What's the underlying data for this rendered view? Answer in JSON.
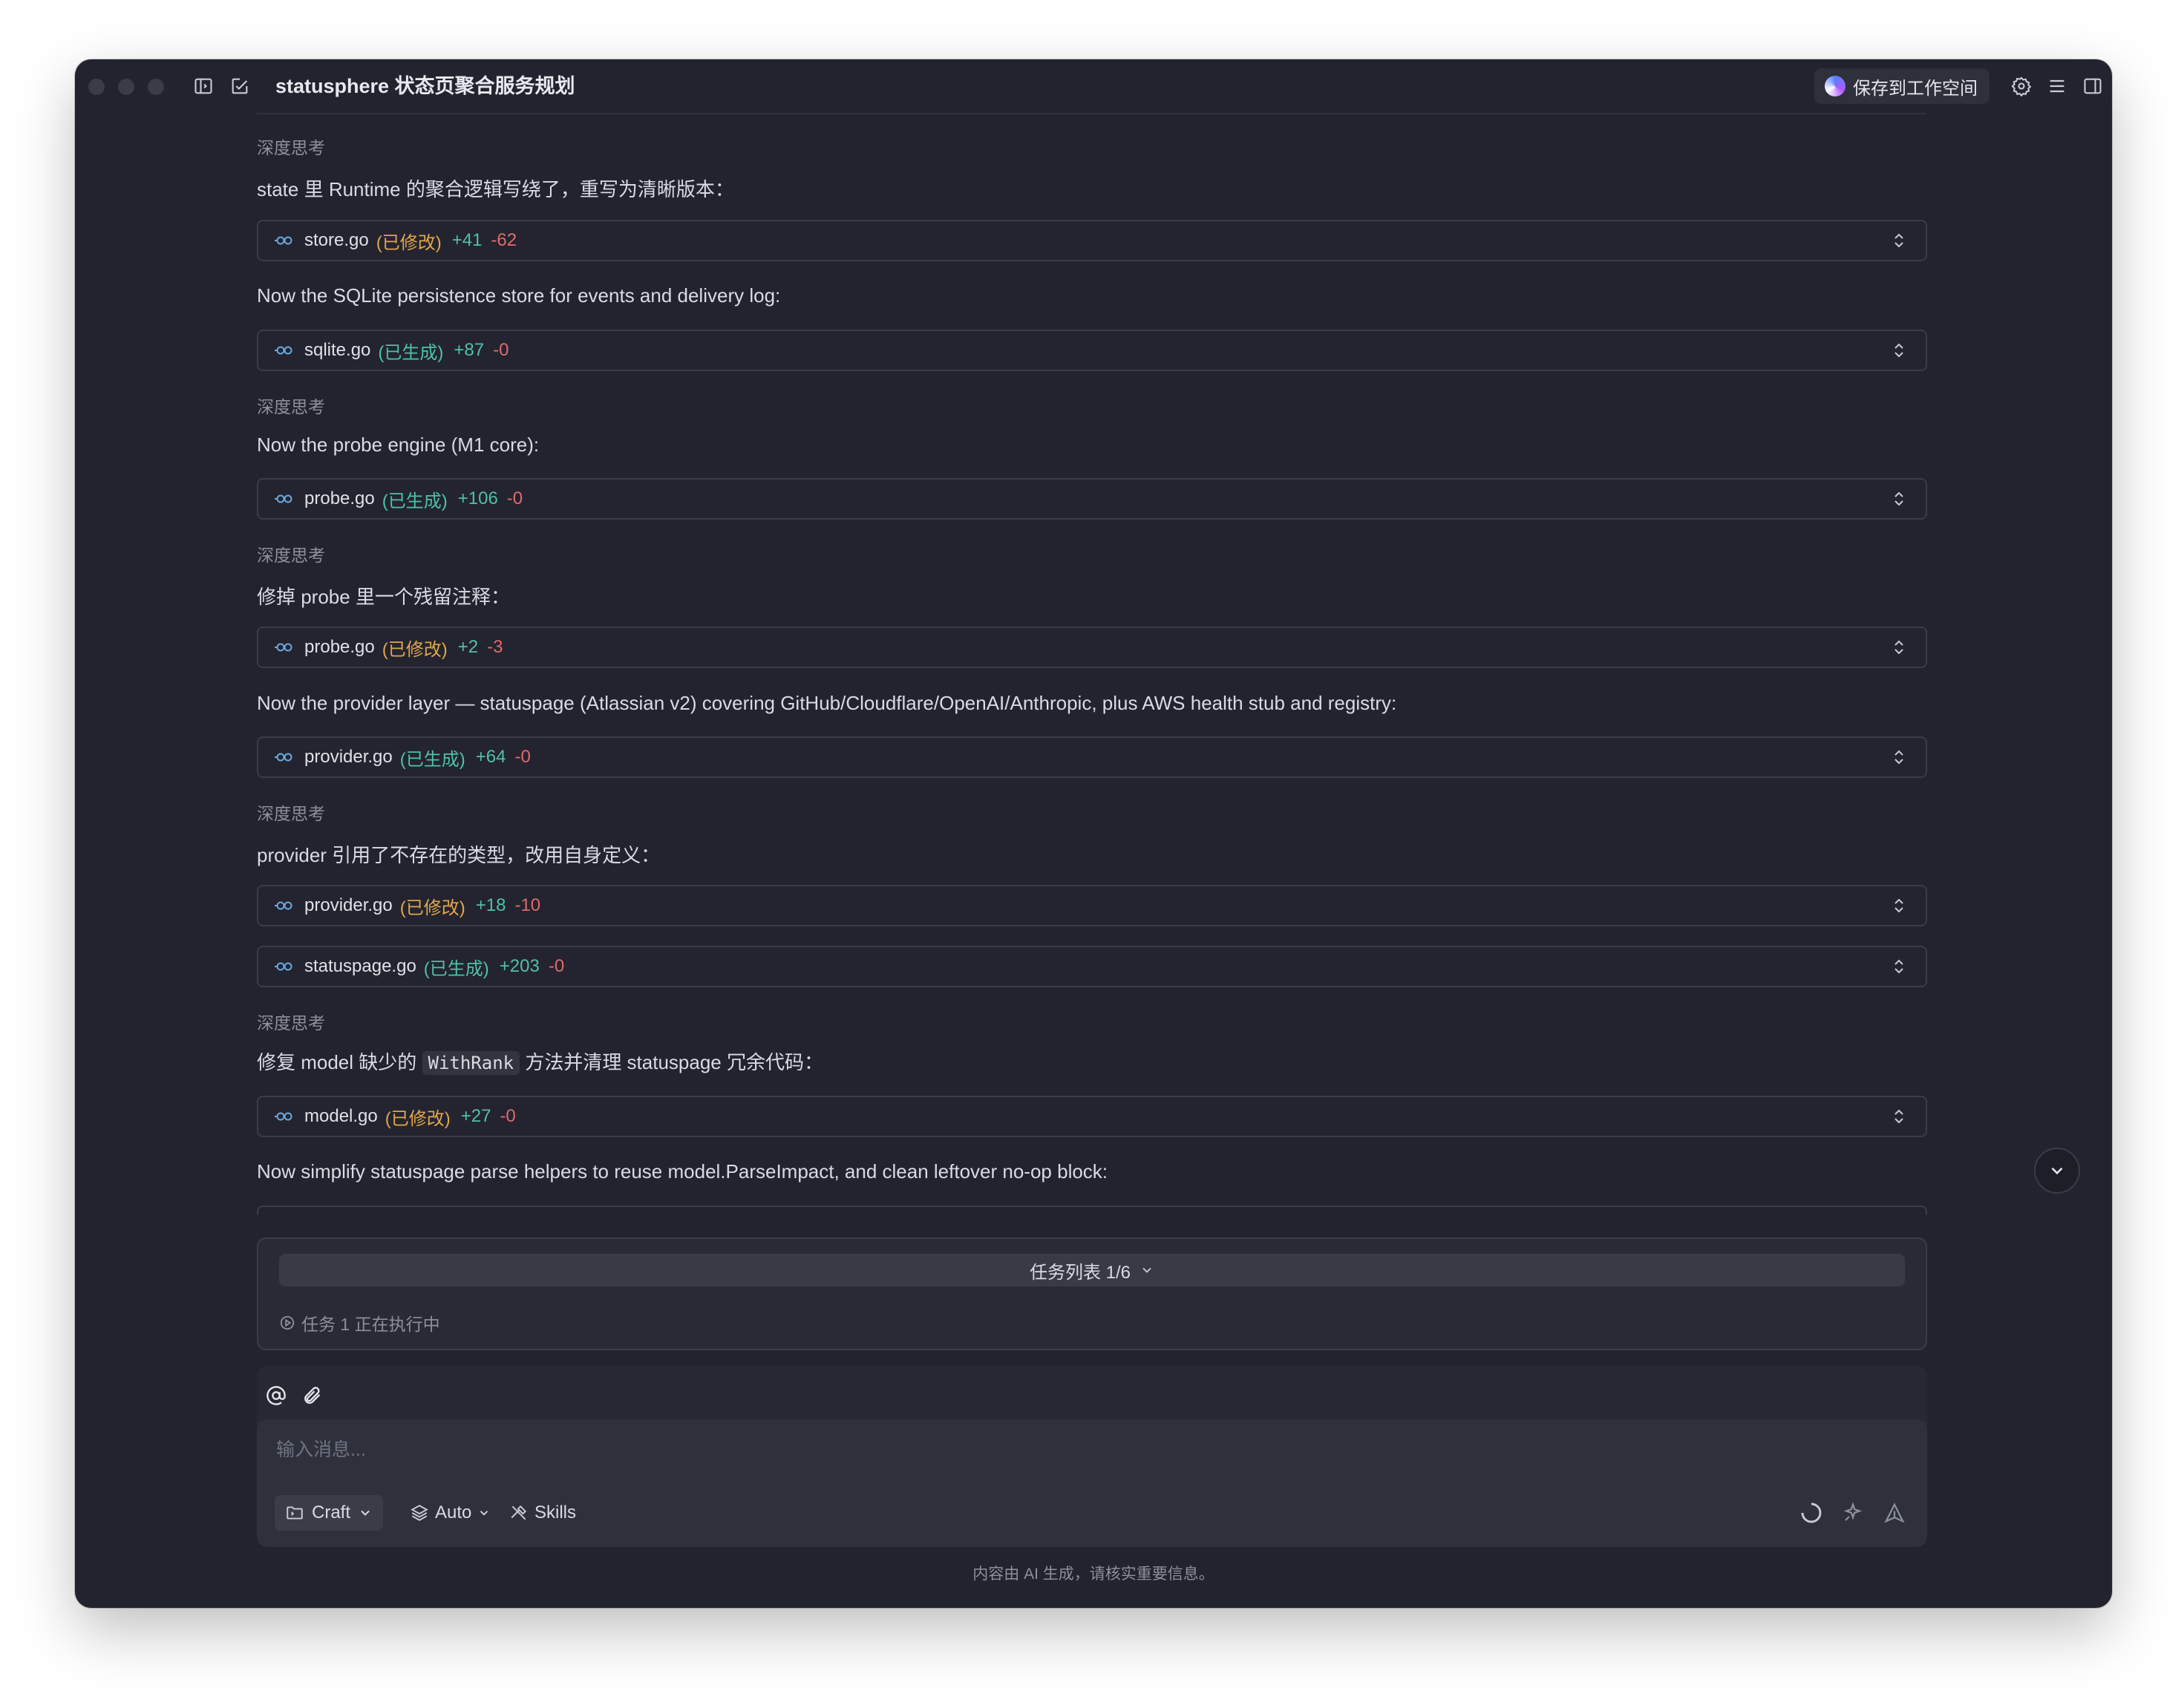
{
  "window": {
    "title": "statusphere 状态页聚合服务规划"
  },
  "header": {
    "save_label": "保存到工作空间"
  },
  "messages": {
    "thinking_label": "深度思考",
    "m1": "state 里 Runtime 的聚合逻辑写绕了，重写为清晰版本：",
    "m2": "Now the SQLite persistence store for events and delivery log:",
    "m3": "Now the probe engine (M1 core):",
    "m4": "修掉 probe 里一个残留注释：",
    "m5": "Now the provider layer — statuspage (Atlassian v2) covering GitHub/Cloudflare/OpenAI/Anthropic, plus AWS health stub and registry:",
    "m6": "provider 引用了不存在的类型，改用自身定义：",
    "m7_prefix": "修复 model 缺少的 ",
    "m7_code": "WithRank",
    "m7_suffix": " 方法并清理 statuspage 冗余代码：",
    "m8": "Now simplify statuspage parse helpers to reuse model.ParseImpact, and clean leftover no-op block:"
  },
  "files": [
    {
      "name": "store.go",
      "status": "(已修改)",
      "add": "+41",
      "del": "-62"
    },
    {
      "name": "sqlite.go",
      "status": "(已生成)",
      "add": "+87",
      "del": "-0"
    },
    {
      "name": "probe.go",
      "status": "(已生成)",
      "add": "+106",
      "del": "-0"
    },
    {
      "name": "probe.go",
      "status": "(已修改)",
      "add": "+2",
      "del": "-3"
    },
    {
      "name": "provider.go",
      "status": "(已生成)",
      "add": "+64",
      "del": "-0"
    },
    {
      "name": "provider.go",
      "status": "(已修改)",
      "add": "+18",
      "del": "-10"
    },
    {
      "name": "statuspage.go",
      "status": "(已生成)",
      "add": "+203",
      "del": "-0"
    },
    {
      "name": "model.go",
      "status": "(已修改)",
      "add": "+27",
      "del": "-0"
    }
  ],
  "tasks": {
    "list_label": "任务列表 1/6",
    "status": "任务 1 正在执行中"
  },
  "composer": {
    "placeholder": "输入消息...",
    "mode_label": "Craft",
    "model_label": "Auto",
    "skills_label": "Skills"
  },
  "footer": {
    "note": "内容由 AI 生成，请核实重要信息。"
  },
  "colors": {
    "window_bg": "#22232f",
    "added": "#4fc0a8",
    "modified": "#e0a64a",
    "deleted": "#e06a6a"
  }
}
